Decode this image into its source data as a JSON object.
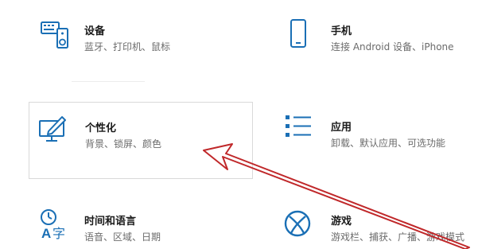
{
  "settings_tiles": [
    {
      "title": "设备",
      "description": "蓝牙、打印机、鼠标",
      "icon": "keyboard-speaker-icon"
    },
    {
      "title": "手机",
      "description": "连接 Android 设备、iPhone",
      "icon": "phone-icon"
    },
    {
      "title": "个性化",
      "description": "背景、锁屏、颜色",
      "icon": "personalization-icon"
    },
    {
      "title": "应用",
      "description": "卸载、默认应用、可选功能",
      "icon": "apps-list-icon"
    },
    {
      "title": "时间和语言",
      "description": "语音、区域、日期",
      "icon": "time-language-icon"
    },
    {
      "title": "游戏",
      "description": "游戏栏、捕获、广播、游戏模式",
      "icon": "xbox-icon"
    }
  ],
  "colors": {
    "accent": "#1a6fb5",
    "annotation_arrow": "#c0282a"
  }
}
